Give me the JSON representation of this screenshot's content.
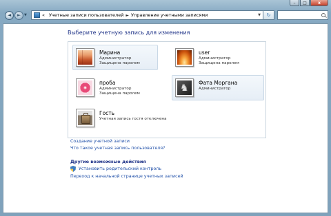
{
  "window": {
    "min_label": "–",
    "max_label": "□",
    "close_label": "x"
  },
  "toolbar": {
    "back_glyph": "◄",
    "forward_glyph": "►",
    "breadcrumbs": [
      "«",
      "Учетные записи пользователей",
      "►",
      "Управление учетными записями"
    ],
    "refresh_glyph": "↻"
  },
  "page": {
    "title": "Выберите учетную запись для изменения"
  },
  "accounts": [
    {
      "name": "Марина",
      "line1": "Администратор",
      "line2": "Защищена паролем",
      "picture": "red-abstract"
    },
    {
      "name": "user",
      "line1": "Администратор",
      "line2": "Защищена паролем",
      "picture": "orange-sunset"
    },
    {
      "name": "проба",
      "line1": "Администратор",
      "line2": "Защищена паролем",
      "picture": "pink-flower"
    },
    {
      "name": "Фата Моргана",
      "line1": "Администратор",
      "line2": "",
      "picture": "dark-chess"
    },
    {
      "name": "Гость",
      "line1": "Учетная запись гостя отключена",
      "line2": "",
      "picture": "briefcase"
    }
  ],
  "links": {
    "create": "Создание учетной записи",
    "what_is": "Что такое учетная запись пользователя?"
  },
  "other_actions": {
    "title": "Другие возможные действия",
    "parental": "Установить родительский контроль",
    "home": "Переход к начальной странице учетных записей"
  },
  "colors": {
    "link": "#1f4fa8",
    "heading": "#1e3287",
    "close_button": "#c7412a"
  }
}
